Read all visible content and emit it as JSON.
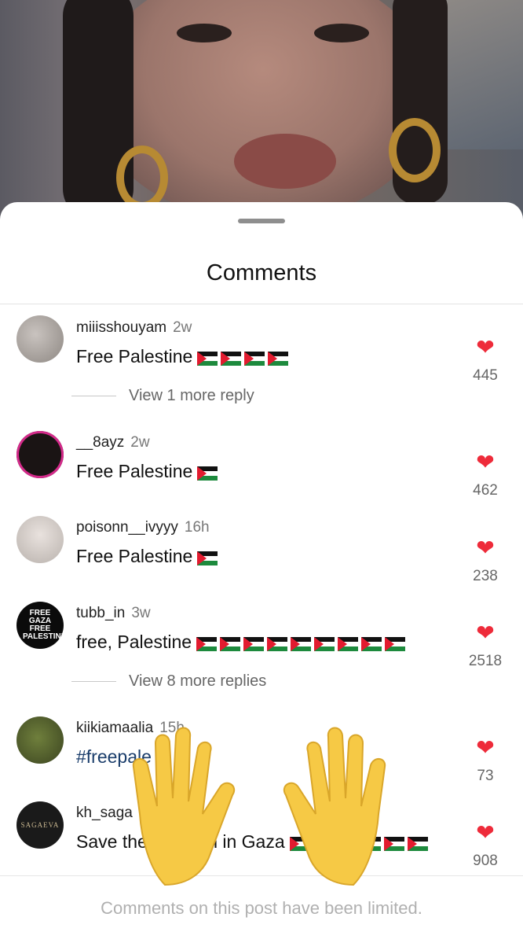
{
  "sheet": {
    "title": "Comments"
  },
  "comments": [
    {
      "user": "miiisshouyam",
      "time": "2w",
      "text": "Free Palestine",
      "flags": 4,
      "likes": "445",
      "replies": "View 1 more reply"
    },
    {
      "user": "__8ayz",
      "time": "2w",
      "text": "Free Palestine",
      "flags": 1,
      "likes": "462"
    },
    {
      "user": "poisonn__ivyyy",
      "time": "16h",
      "text": "Free Palestine",
      "flags": 1,
      "likes": "238"
    },
    {
      "user": "tubb_in",
      "time": "3w",
      "text": "free, Palestine",
      "flags": 9,
      "likes": "2518",
      "replies": "View 8 more replies",
      "avatar_text": "FREE GAZA FREE PALESTINE"
    },
    {
      "user": "kiikiamaalia",
      "time": "15h",
      "text": "#freepale",
      "flags": 0,
      "likes": "73"
    },
    {
      "user": "kh_saga",
      "time": "",
      "text": "Save the",
      "text2": "n in Gaza",
      "flags": 6,
      "likes": "908",
      "avatar_text": "SAGAEVA"
    }
  ],
  "footer": {
    "text": "Comments on this post have been limited."
  },
  "colors": {
    "heart": "#ee2b3a",
    "text": "#111111",
    "muted": "#777777"
  }
}
